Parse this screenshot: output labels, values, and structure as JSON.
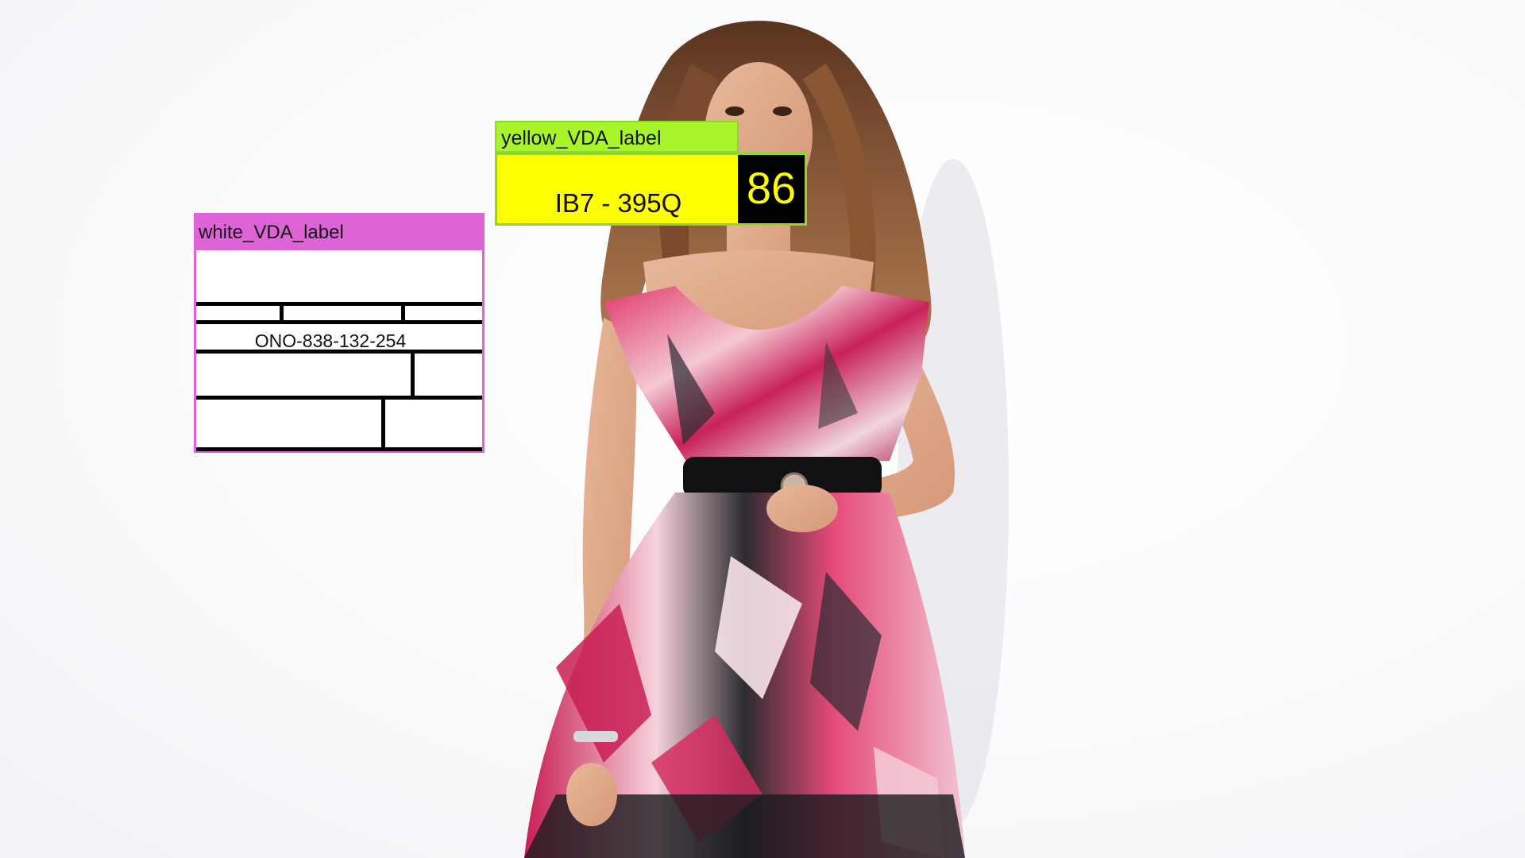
{
  "image": {
    "description_icon": "woman-in-floral-dress-photo"
  },
  "labels": {
    "yellow": {
      "header": "yellow_VDA_label",
      "code": "IB7 - 395Q",
      "number": "86",
      "colors": {
        "header_bg": "#a8f52c",
        "body_bg": "#ffff00",
        "number_bg": "#000000",
        "number_fg": "#ffff00"
      }
    },
    "white": {
      "header": "white_VDA_label",
      "code": "ONO-838-132-254",
      "colors": {
        "header_bg": "#dc64d6",
        "body_bg": "#ffffff",
        "lines": "#000000"
      }
    }
  }
}
